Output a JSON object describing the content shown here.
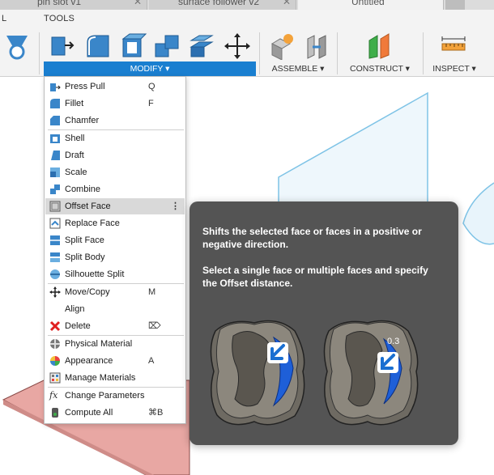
{
  "tabs": [
    {
      "label": "pin slot v1"
    },
    {
      "label": "surface follower v2"
    },
    {
      "label": "Untitled"
    }
  ],
  "menubar": {
    "left_label": "L",
    "tools_label": "TOOLS"
  },
  "ribbon_groups": {
    "modify": "MODIFY ▾",
    "assemble": "ASSEMBLE ▾",
    "construct": "CONSTRUCT ▾",
    "inspect": "INSPECT ▾"
  },
  "accent_color": "#1a7fd0",
  "modify_menu": {
    "items": [
      {
        "label": "Press Pull",
        "shortcut": "Q",
        "icon": "press-pull-icon"
      },
      {
        "label": "Fillet",
        "shortcut": "F",
        "icon": "fillet-icon"
      },
      {
        "label": "Chamfer",
        "shortcut": "",
        "icon": "chamfer-icon"
      },
      {
        "label": "Shell",
        "shortcut": "",
        "icon": "shell-icon"
      },
      {
        "label": "Draft",
        "shortcut": "",
        "icon": "draft-icon"
      },
      {
        "label": "Scale",
        "shortcut": "",
        "icon": "scale-icon"
      },
      {
        "label": "Combine",
        "shortcut": "",
        "icon": "combine-icon"
      },
      {
        "label": "Offset Face",
        "shortcut": "",
        "icon": "offset-face-icon",
        "highlighted": true,
        "more": "⋮"
      },
      {
        "label": "Replace Face",
        "shortcut": "",
        "icon": "replace-face-icon"
      },
      {
        "label": "Split Face",
        "shortcut": "",
        "icon": "split-face-icon"
      },
      {
        "label": "Split Body",
        "shortcut": "",
        "icon": "split-body-icon"
      },
      {
        "label": "Silhouette Split",
        "shortcut": "",
        "icon": "silhouette-split-icon"
      },
      {
        "label": "Move/Copy",
        "shortcut": "M",
        "icon": "move-icon"
      },
      {
        "label": "Align",
        "shortcut": "",
        "icon": "align-icon"
      },
      {
        "label": "Delete",
        "shortcut": "⌦",
        "icon": "delete-icon"
      },
      {
        "label": "Physical Material",
        "shortcut": "",
        "icon": "physical-material-icon"
      },
      {
        "label": "Appearance",
        "shortcut": "A",
        "icon": "appearance-icon"
      },
      {
        "label": "Manage Materials",
        "shortcut": "",
        "icon": "manage-materials-icon"
      },
      {
        "label": "Change Parameters",
        "shortcut": "",
        "icon": "fx-icon"
      },
      {
        "label": "Compute All",
        "shortcut": "⌘B",
        "icon": "compute-all-icon"
      }
    ]
  },
  "tooltip": {
    "line1": "Shifts the selected face or faces in a positive or negative direction.",
    "line2": "Select a single face or multiple faces and specify the Offset distance.",
    "dimension_label": "0.3"
  }
}
